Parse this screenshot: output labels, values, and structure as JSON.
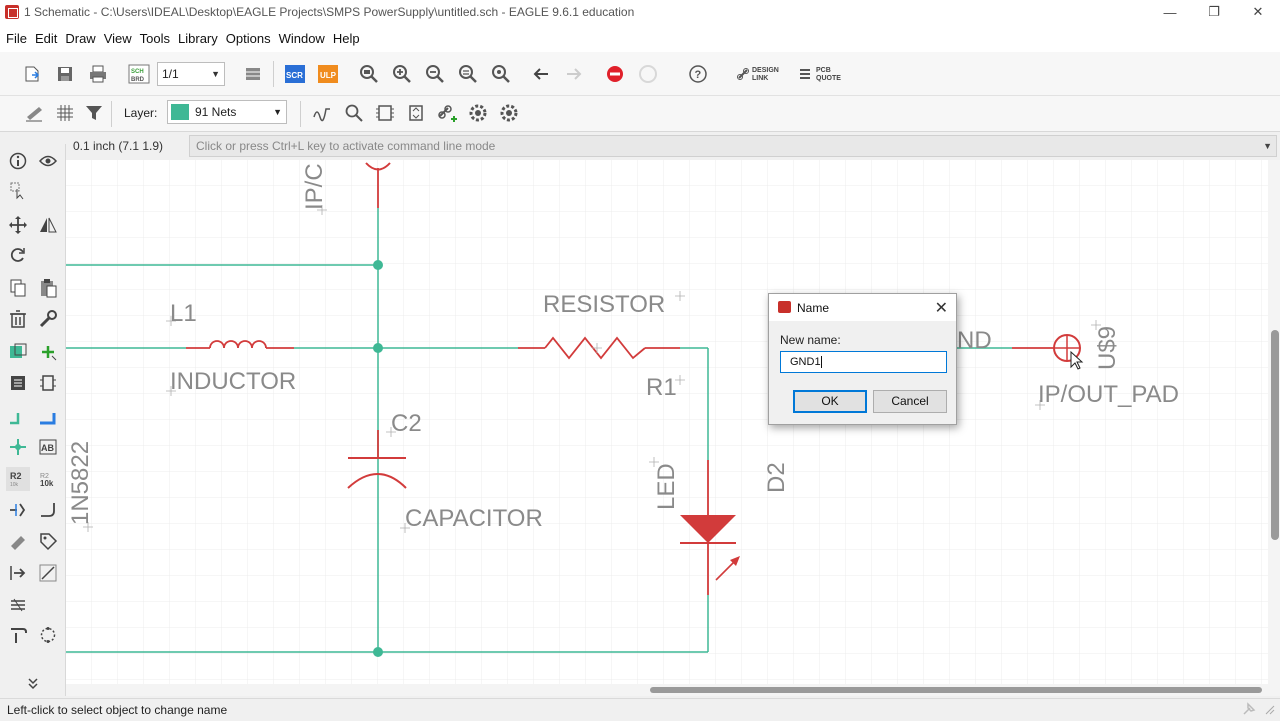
{
  "window": {
    "title": "1 Schematic - C:\\Users\\IDEAL\\Desktop\\EAGLE Projects\\SMPS PowerSupply\\untitled.sch - EAGLE 9.6.1 education",
    "minimize": "—",
    "restore": "❐",
    "close": "✕"
  },
  "menu": [
    "File",
    "Edit",
    "Draw",
    "View",
    "Tools",
    "Library",
    "Options",
    "Window",
    "Help"
  ],
  "toolbar": {
    "sheet_value": "1/1",
    "scr_label": "SCR",
    "ulp_label": "ULP",
    "brd_label": "BRD",
    "design_link": [
      "DESIGN",
      "LINK"
    ],
    "pcb_quote": [
      "PCB",
      "QUOTE"
    ],
    "layer_label": "Layer:",
    "layer_value": "91 Nets",
    "layer_color": "#3fb895"
  },
  "command": {
    "coordinate": "0.1 inch (7.1 1.9)",
    "placeholder": "Click or press Ctrl+L key to activate command line mode"
  },
  "schematic": {
    "net_color": "#3fb895",
    "part_color": "#d23b3b",
    "text_color": "#8a8a8a",
    "labels": {
      "ipc": "IP/C",
      "l1": "L1",
      "inductor": "INDUCTOR",
      "resistor": "RESISTOR",
      "r1": "R1",
      "c2": "C2",
      "capacitor": "CAPACITOR",
      "led": "LED",
      "d2": "D2",
      "diode": "1N5822",
      "gnd": "ND",
      "u": "U$9",
      "pad": "IP/OUT_PAD"
    }
  },
  "dialog": {
    "title": "Name",
    "label": "New name:",
    "value": "GND1",
    "ok": "OK",
    "cancel": "Cancel"
  },
  "status": {
    "text": "Left-click to select object to change name"
  }
}
